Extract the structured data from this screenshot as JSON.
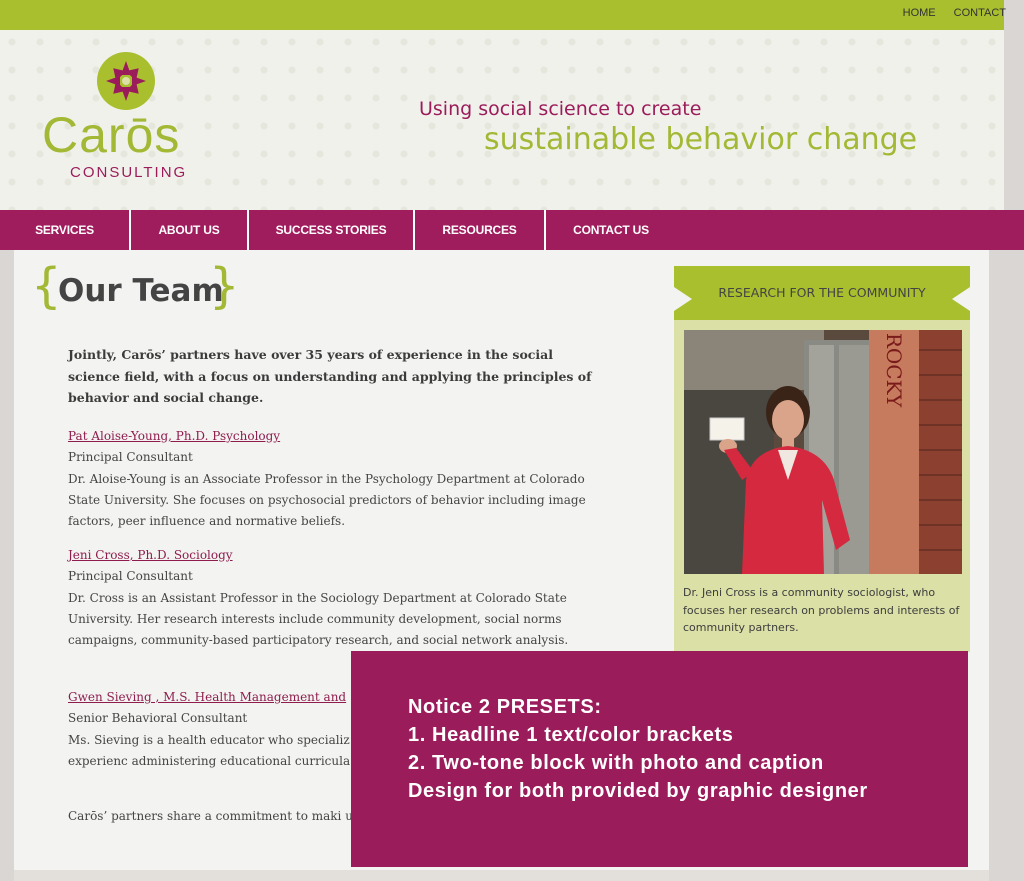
{
  "top_links": [
    "HOME",
    "CONTACT"
  ],
  "logo": {
    "name": "Carōs",
    "sub": "CONSULTING"
  },
  "tagline": {
    "line1": "Using social science to create",
    "line2": "sustainable behavior change"
  },
  "nav": [
    "SERVICES",
    "ABOUT US",
    "SUCCESS STORIES",
    "RESOURCES",
    "CONTACT US"
  ],
  "page_title": {
    "open": "{",
    "text": "Our Team",
    "close": "}"
  },
  "intro": "Jointly, Carōs’ partners have over 35 years of experience in the social science field, with a focus on understanding and applying the principles of behavior and social change.",
  "team": [
    {
      "name": "Pat Aloise-Young, Ph.D. Psychology",
      "role": "Principal Consultant",
      "bio": "Dr. Aloise-Young is an Associate Professor in the Psychology Department at Colorado State University. She focuses on psychosocial predictors of behavior including image factors, peer influence and normative beliefs."
    },
    {
      "name": "Jeni Cross, Ph.D. Sociology",
      "role": "Principal Consultant",
      "bio": "Dr. Cross is an Assistant Professor in the Sociology Department at Colorado State University. Her research interests include community development, social norms campaigns, community-based participatory research, and social network analysis."
    },
    {
      "name": "Gwen Sieving , M.S. Health Management and",
      "role": "Senior Behavioral Consultant",
      "bio": "Ms. Sieving is a health educator who specializ their health behaviors. She also has experienc administering educational curricula."
    }
  ],
  "outro": "Carōs’ partners share a commitment to maki useful to society.",
  "sidebar": {
    "title": "RESEARCH FOR THE COMMUNITY",
    "photo_text": "ROCKY",
    "caption": "Dr. Jeni Cross is a community sociologist, who focuses her research on problems and interests of community partners."
  },
  "overlay": {
    "lines": [
      "Notice 2 PRESETS:",
      "1. Headline 1 text/color brackets",
      "2. Two-tone block with photo and caption",
      "Design for both provided by graphic designer"
    ]
  },
  "colors": {
    "green": "#a9bf2e",
    "magenta": "#9b1c5a",
    "page": "#f3f3f1"
  }
}
